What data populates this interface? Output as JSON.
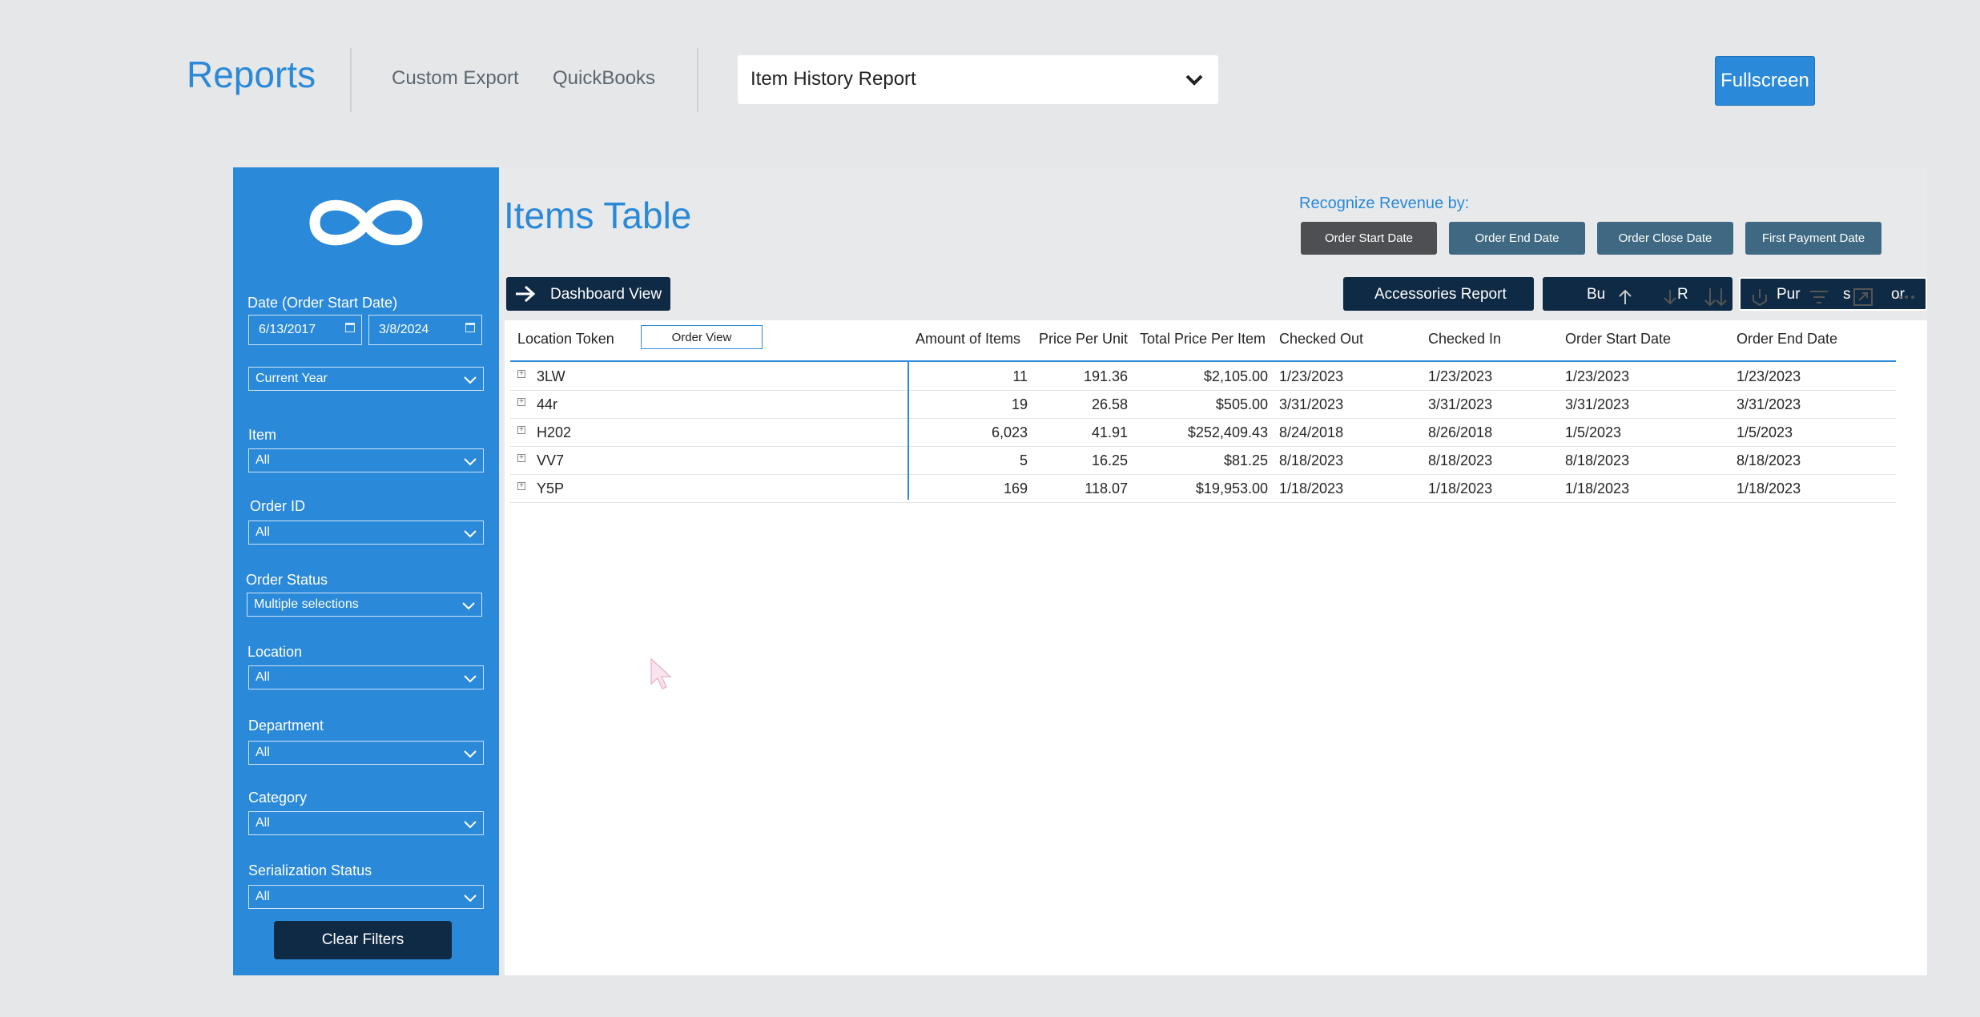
{
  "nav": {
    "brand": "Reports",
    "custom_export": "Custom Export",
    "quickbooks": "QuickBooks",
    "report_select": "Item History Report",
    "fullscreen": "Fullscreen"
  },
  "sidebar": {
    "date_label": "Date (Order Start Date)",
    "date_start": "6/13/2017",
    "date_end": "3/8/2024",
    "period": "Current Year",
    "filters": [
      {
        "label": "Item",
        "value": "All"
      },
      {
        "label": "Order ID",
        "value": "All"
      },
      {
        "label": "Order Status",
        "value": "Multiple selections"
      },
      {
        "label": "Location",
        "value": "All"
      },
      {
        "label": "Department",
        "value": "All"
      },
      {
        "label": "Category",
        "value": "All"
      },
      {
        "label": "Serialization Status",
        "value": "All"
      }
    ],
    "clear_filters": "Clear Filters"
  },
  "main": {
    "title": "Items Table",
    "recognize_label": "Recognize Revenue by:",
    "revenue_buttons": [
      "Order Start Date",
      "Order End Date",
      "Order Close Date",
      "First Payment Date"
    ],
    "dashboard_view": "Dashboard View",
    "accessories_report": "Accessories Report",
    "partial_btn_a": "Bu",
    "partial_btn_b": "R",
    "partial_btn_c": "Pur",
    "partial_btn_d": "s",
    "partial_btn_e": "or",
    "order_view": "Order View"
  },
  "table": {
    "columns": [
      "Location Token",
      "Amount of Items",
      "Price Per Unit",
      "Total Price Per Item",
      "Checked Out",
      "Checked In",
      "Order Start Date",
      "Order End Date"
    ],
    "rows": [
      {
        "token": "3LW",
        "amount": "11",
        "ppu": "191.36",
        "total": "$2,105.00",
        "out": "1/23/2023",
        "in": "1/23/2023",
        "start": "1/23/2023",
        "end": "1/23/2023"
      },
      {
        "token": "44r",
        "amount": "19",
        "ppu": "26.58",
        "total": "$505.00",
        "out": "3/31/2023",
        "in": "3/31/2023",
        "start": "3/31/2023",
        "end": "3/31/2023"
      },
      {
        "token": "H202",
        "amount": "6,023",
        "ppu": "41.91",
        "total": "$252,409.43",
        "out": "8/24/2018",
        "in": "8/26/2018",
        "start": "1/5/2023",
        "end": "1/5/2023"
      },
      {
        "token": "VV7",
        "amount": "5",
        "ppu": "16.25",
        "total": "$81.25",
        "out": "8/18/2023",
        "in": "8/18/2023",
        "start": "8/18/2023",
        "end": "8/18/2023"
      },
      {
        "token": "Y5P",
        "amount": "169",
        "ppu": "118.07",
        "total": "$19,953.00",
        "out": "1/18/2023",
        "in": "1/18/2023",
        "start": "1/18/2023",
        "end": "1/18/2023"
      }
    ]
  },
  "colors": {
    "accent": "#2a89d8",
    "dark_navy": "#0f2a44",
    "active_btn": "#4d4f52",
    "inactive_btn": "#3f6982"
  },
  "icons": [
    "chevron-down-icon",
    "calendar-icon",
    "arrow-right-icon",
    "sort-up-icon",
    "sort-down-icon",
    "expand-all-icon",
    "drill-icon",
    "filter-icon",
    "focus-mode-icon",
    "more-options-icon",
    "infinity-logo"
  ]
}
